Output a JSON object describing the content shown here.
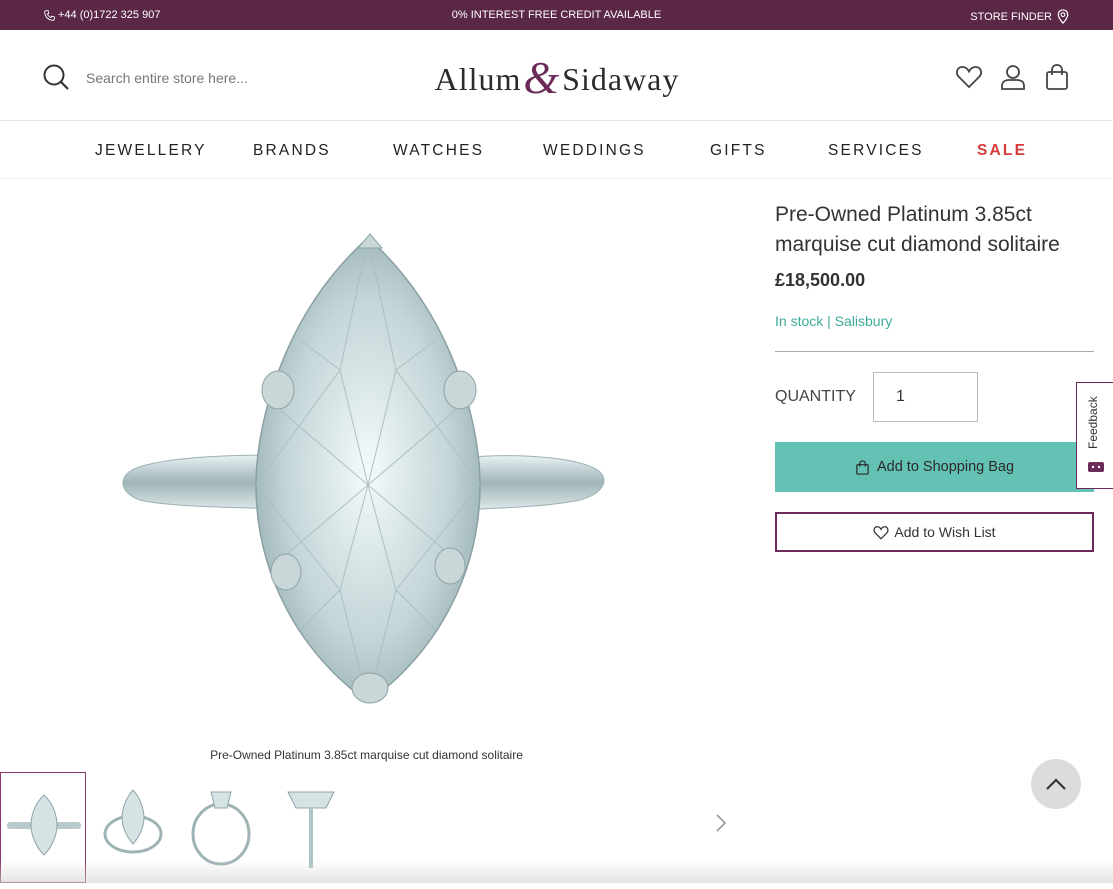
{
  "topbar": {
    "phone": "+44 (0)1722 325 907",
    "credit": "0% INTEREST FREE CREDIT AVAILABLE",
    "store_finder": "STORE FINDER"
  },
  "header": {
    "search_placeholder": "Search entire store here...",
    "logo": {
      "part1": "Allum",
      "amp": "&",
      "part2": "Sidaway"
    }
  },
  "nav": {
    "items": [
      "JEWELLERY",
      "BRANDS",
      "WATCHES",
      "WEDDINGS",
      "GIFTS",
      "SERVICES",
      "SALE"
    ]
  },
  "gallery": {
    "caption": "Pre-Owned Platinum 3.85ct marquise cut diamond solitaire",
    "thumbnail_count": 4,
    "active_thumbnail": 1
  },
  "product": {
    "title": "Pre-Owned Platinum 3.85ct marquise cut diamond solitaire",
    "price": "£18,500.00",
    "stock": "In stock | Salisbury",
    "quantity_label": "QUANTITY",
    "quantity_value": "1",
    "add_to_bag": "Add to Shopping Bag",
    "add_to_wishlist": "Add to Wish List"
  },
  "feedback": {
    "label": "Feedback"
  },
  "colors": {
    "topbar": "#5b2747",
    "accent": "#64c2b4",
    "sale": "#d63a3a",
    "brand": "#6b2a57"
  },
  "icons": [
    "phone-icon",
    "map-pin-icon",
    "search-icon",
    "heart-icon",
    "user-icon",
    "bag-icon",
    "chevron-right-icon",
    "chevron-up-icon"
  ]
}
